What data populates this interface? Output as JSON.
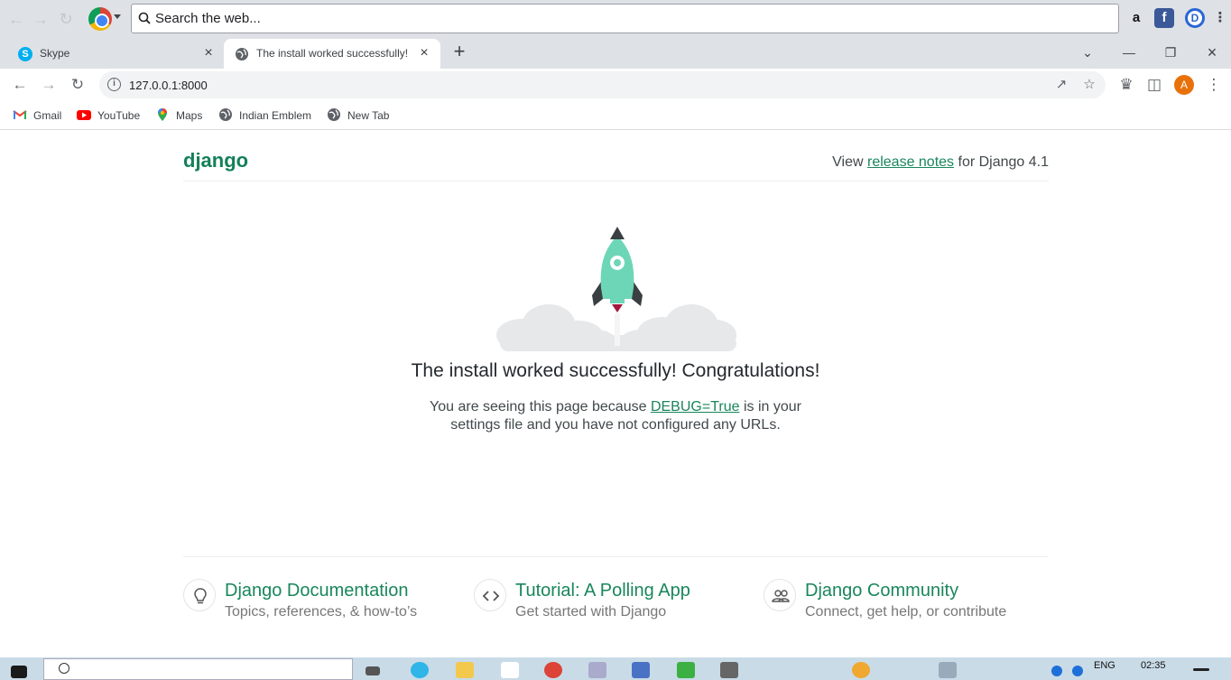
{
  "top_search": {
    "placeholder": "Search the web..."
  },
  "tabs": [
    {
      "title": "Skype",
      "favicon": "skype-icon"
    },
    {
      "title": "The install worked successfully! C",
      "favicon": "globe-icon",
      "active": true
    }
  ],
  "address_bar": {
    "url": "127.0.0.1:8000"
  },
  "profile": {
    "initial": "A"
  },
  "bookmarks": [
    {
      "label": "Gmail",
      "icon": "gmail-icon"
    },
    {
      "label": "YouTube",
      "icon": "youtube-icon"
    },
    {
      "label": "Maps",
      "icon": "maps-icon"
    },
    {
      "label": "Indian Emblem",
      "icon": "globe-icon"
    },
    {
      "label": "New Tab",
      "icon": "globe-icon"
    }
  ],
  "django": {
    "logo": "django",
    "release_prefix": "View ",
    "release_link": "release notes",
    "release_suffix": " for Django 4.1",
    "headline": "The install worked successfully! Congratulations!",
    "sub_prefix": "You are seeing this page because ",
    "sub_link": "DEBUG=True",
    "sub_mid": " is in your",
    "sub_line2": "settings file and you have not configured any URLs.",
    "cards": [
      {
        "title": "Django Documentation",
        "desc": "Topics, references, & how-to’s",
        "icon": "lightbulb-icon"
      },
      {
        "title": "Tutorial: A Polling App",
        "desc": "Get started with Django",
        "icon": "code-icon"
      },
      {
        "title": "Django Community",
        "desc": "Connect, get help, or contribute",
        "icon": "people-icon"
      }
    ]
  },
  "taskbar": {
    "lang": "ENG",
    "time": "02:35"
  },
  "colors": {
    "django_green": "#19865c",
    "tab_strip": "#dee1e6",
    "rocket": "#6dd6b6"
  }
}
